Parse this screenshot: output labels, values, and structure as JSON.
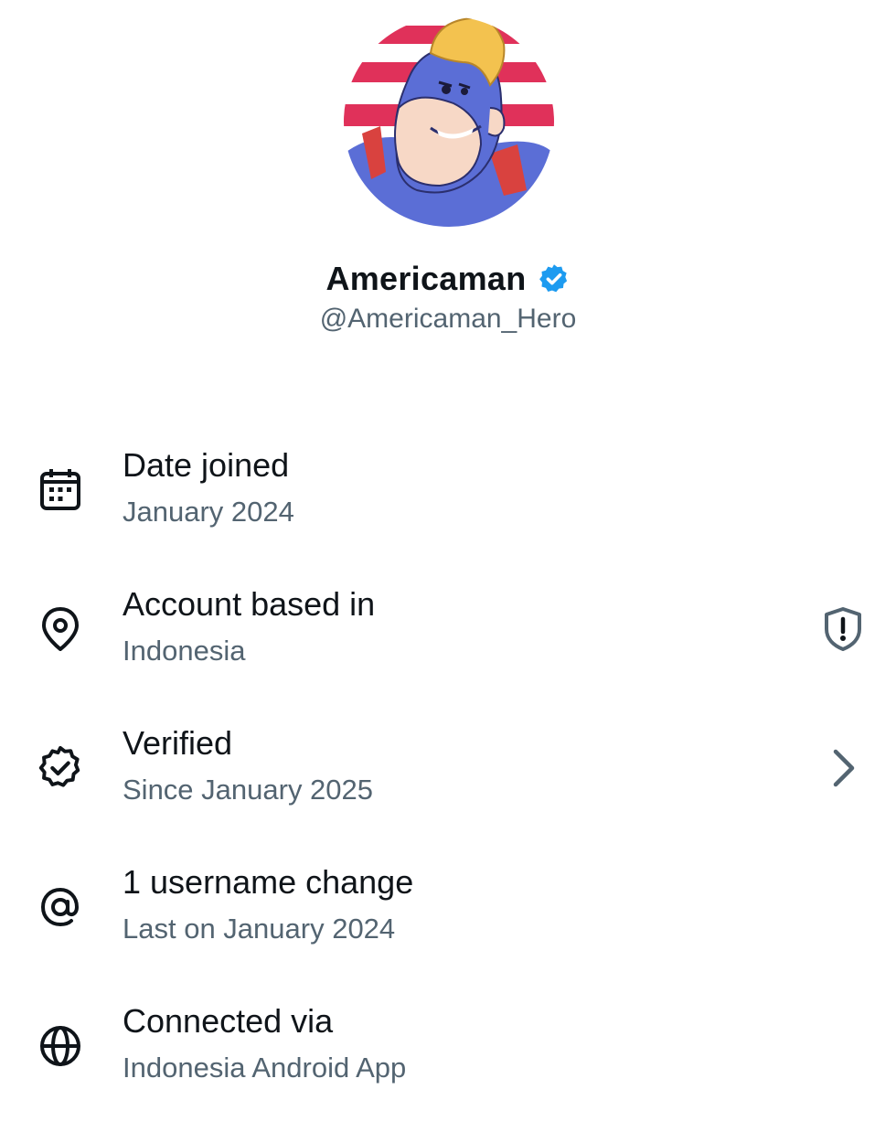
{
  "profile": {
    "display_name": "Americaman",
    "handle": "@Americaman_Hero",
    "avatar_icon": "cartoon-hero-avatar",
    "verified_icon": "verified-badge-icon"
  },
  "colors": {
    "verified_blue": "#1d9bf0",
    "text_primary": "#0f1419",
    "text_secondary": "#536471",
    "avatar_stripe_red": "#e0315a",
    "avatar_skin_blue": "#5b6ed6"
  },
  "rows": [
    {
      "icon": "calendar-icon",
      "title": "Date joined",
      "subtitle": "January 2024"
    },
    {
      "icon": "location-pin-icon",
      "title": "Account based in",
      "subtitle": "Indonesia",
      "trailing_icon": "shield-alert-icon"
    },
    {
      "icon": "verified-outline-icon",
      "title": "Verified",
      "subtitle": "Since January 2025",
      "trailing_icon": "chevron-right-icon"
    },
    {
      "icon": "at-sign-icon",
      "title": "1 username change",
      "subtitle": "Last on January 2024"
    },
    {
      "icon": "globe-icon",
      "title": "Connected via",
      "subtitle": "Indonesia Android App"
    }
  ]
}
